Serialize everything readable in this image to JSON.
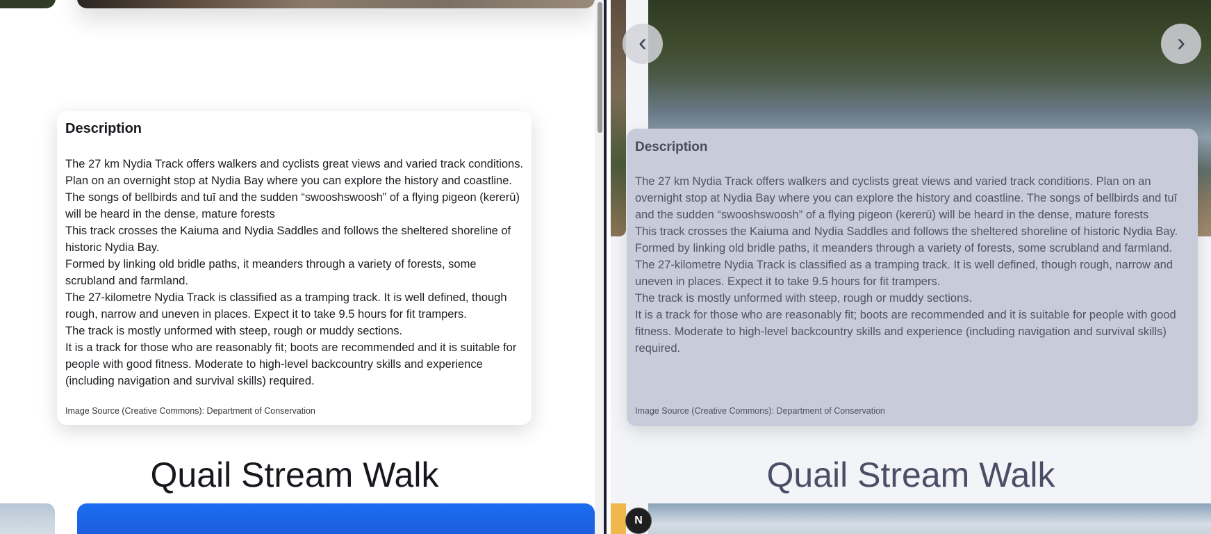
{
  "left": {
    "card": {
      "title": "Description",
      "paragraphs": [
        "The 27 km Nydia Track offers walkers and cyclists great views and varied track conditions. Plan on an overnight stop at Nydia Bay where you can explore the history and coastline. The songs of bellbirds and tuī and the sudden “swooshswoosh” of a flying pigeon (kererū) will be heard in the dense, mature forests",
        "This track crosses the Kaiuma and Nydia Saddles and follows the sheltered shoreline of historic Nydia Bay.",
        "Formed by linking old bridle paths, it meanders through a variety of forests, some scrubland and farmland.",
        "The 27-kilometre Nydia Track is classified as a tramping track. It is well defined, though rough, narrow and uneven in places. Expect it to take 9.5 hours for fit trampers.",
        "The track is mostly unformed with steep, rough or muddy sections.",
        "It is a track for those who are reasonably fit; boots are recommended and it is suitable for people with good fitness. Moderate to high-level backcountry skills and experience (including navigation and survival skills) required."
      ],
      "source": "Image Source (Creative Commons): Department of Conservation"
    },
    "next_heading": "Quail Stream Walk"
  },
  "right": {
    "nav": {
      "prev_icon": "chevron-left-icon",
      "prev_glyph": "‹",
      "next_icon": "chevron-right-icon",
      "next_glyph": "›"
    },
    "card": {
      "title": "Description",
      "paragraphs": [
        "The 27 km Nydia Track offers walkers and cyclists great views and varied track conditions. Plan on an overnight stop at Nydia Bay where you can explore the history and coastline. The songs of bellbirds and tuī and the sudden “swooshswoosh” of a flying pigeon (kererū) will be heard in the dense, mature forests",
        "This track crosses the Kaiuma and Nydia Saddles and follows the sheltered shoreline of historic Nydia Bay.",
        "Formed by linking old bridle paths, it meanders through a variety of forests, some scrubland and farmland.",
        "The 27-kilometre Nydia Track is classified as a tramping track. It is well defined, though rough, narrow and uneven in places. Expect it to take 9.5 hours for fit trampers.",
        "The track is mostly unformed with steep, rough or muddy sections.",
        "It is a track for those who are reasonably fit; boots are recommended and it is suitable for people with good fitness. Moderate to high-level backcountry skills and experience (including navigation and survival skills) required."
      ],
      "source": "Image Source (Creative Commons): Department of Conservation"
    },
    "next_heading": "Quail Stream Walk",
    "badge": "N"
  }
}
